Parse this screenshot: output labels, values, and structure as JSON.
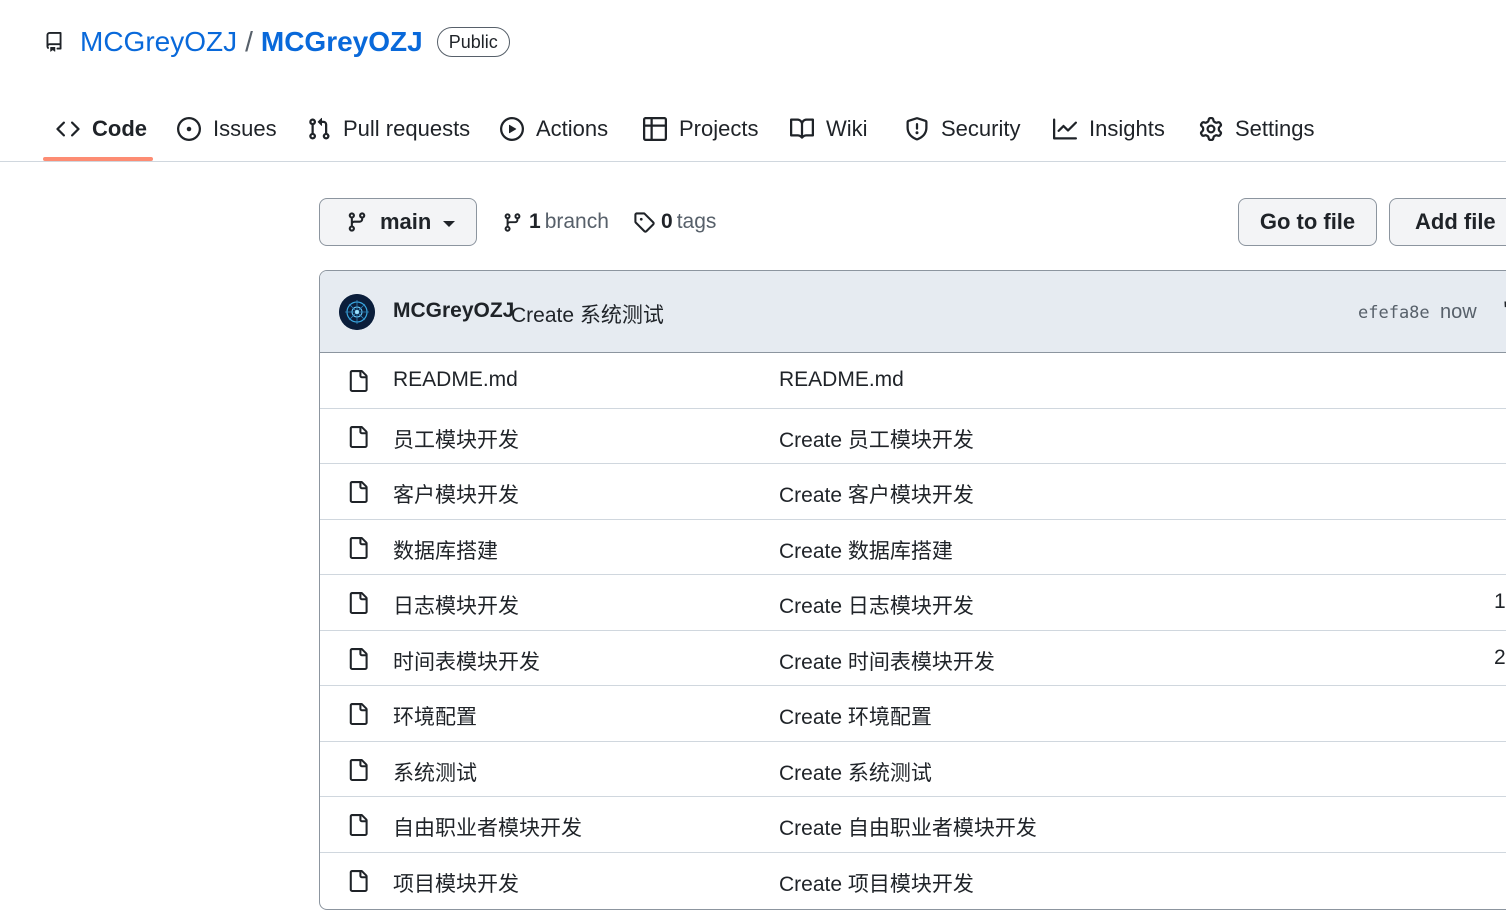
{
  "repo": {
    "owner": "MCGreyOZJ",
    "separator": "/",
    "name": "MCGreyOZJ",
    "visibility": "Public"
  },
  "tabs": [
    {
      "label": "Code",
      "icon": "code-icon",
      "active": true
    },
    {
      "label": "Issues",
      "icon": "issue-opened-icon"
    },
    {
      "label": "Pull requests",
      "icon": "git-pull-request-icon"
    },
    {
      "label": "Actions",
      "icon": "play-icon"
    },
    {
      "label": "Projects",
      "icon": "table-icon"
    },
    {
      "label": "Wiki",
      "icon": "book-icon"
    },
    {
      "label": "Security",
      "icon": "shield-icon"
    },
    {
      "label": "Insights",
      "icon": "graph-icon"
    },
    {
      "label": "Settings",
      "icon": "gear-icon"
    }
  ],
  "branch_bar": {
    "current_branch": "main",
    "branch_count": "1",
    "branch_label": "branch",
    "tag_count": "0",
    "tag_label": "tags",
    "go_to_file": "Go to file",
    "add_file": "Add file"
  },
  "latest_commit": {
    "author": "MCGreyOZJ",
    "message": "Create 系统测试",
    "sha": "efefa8e",
    "time": "now",
    "clipped_trailing": "\""
  },
  "files": [
    {
      "name": "README.md",
      "commit": "README.md",
      "age": ""
    },
    {
      "name": "员工模块开发",
      "commit": "Create 员工模块开发",
      "age": ""
    },
    {
      "name": "客户模块开发",
      "commit": "Create 客户模块开发",
      "age": ""
    },
    {
      "name": "数据库搭建",
      "commit": "Create 数据库搭建",
      "age": ""
    },
    {
      "name": "日志模块开发",
      "commit": "Create 日志模块开发",
      "age": "1"
    },
    {
      "name": "时间表模块开发",
      "commit": "Create 时间表模块开发",
      "age": "2"
    },
    {
      "name": "环境配置",
      "commit": "Create 环境配置",
      "age": ""
    },
    {
      "name": "系统测试",
      "commit": "Create 系统测试",
      "age": ""
    },
    {
      "name": "自由职业者模块开发",
      "commit": "Create 自由职业者模块开发",
      "age": ""
    },
    {
      "name": "项目模块开发",
      "commit": "Create 项目模块开发",
      "age": ""
    }
  ],
  "colors": {
    "link": "#0969da",
    "active_tab_underline": "#fd8c73",
    "commit_bar_bg": "#e6ebf1",
    "border": "#d0d7de"
  }
}
